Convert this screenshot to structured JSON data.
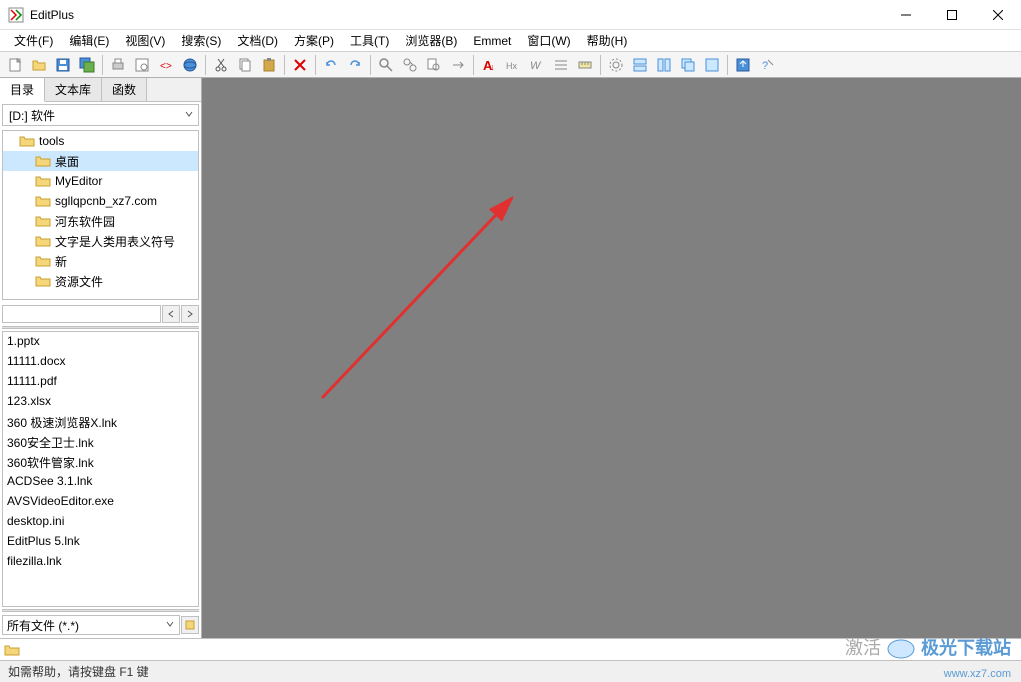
{
  "app": {
    "title": "EditPlus"
  },
  "menu": {
    "items": [
      "文件(F)",
      "编辑(E)",
      "视图(V)",
      "搜索(S)",
      "文档(D)",
      "方案(P)",
      "工具(T)",
      "浏览器(B)",
      "Emmet",
      "窗口(W)",
      "帮助(H)"
    ]
  },
  "sidebar": {
    "tabs": [
      "目录",
      "文本库",
      "函数"
    ],
    "drive": "[D:] 软件",
    "folders": [
      {
        "name": "tools",
        "indent": 1,
        "selected": false
      },
      {
        "name": "桌面",
        "indent": 2,
        "selected": true
      },
      {
        "name": "MyEditor",
        "indent": 2,
        "selected": false
      },
      {
        "name": "sgllqpcnb_xz7.com",
        "indent": 2,
        "selected": false
      },
      {
        "name": "河东软件园",
        "indent": 2,
        "selected": false
      },
      {
        "name": "文字是人类用表义符号",
        "indent": 2,
        "selected": false
      },
      {
        "name": "新",
        "indent": 2,
        "selected": false
      },
      {
        "name": "资源文件",
        "indent": 2,
        "selected": false
      }
    ],
    "files": [
      "1.pptx",
      "11111.docx",
      "11111.pdf",
      "123.xlsx",
      "360 极速浏览器X.lnk",
      "360安全卫士.lnk",
      "360软件管家.lnk",
      "ACDSee 3.1.lnk",
      "AVSVideoEditor.exe",
      "desktop.ini",
      "EditPlus 5.lnk",
      "filezilla.lnk"
    ],
    "filter": "所有文件 (*.*)"
  },
  "statusbar": {
    "help": "如需帮助，请按键盘 F1 键"
  },
  "watermark": {
    "text1": "激活",
    "text2": "极光下载站",
    "url": "www.xz7.com"
  }
}
